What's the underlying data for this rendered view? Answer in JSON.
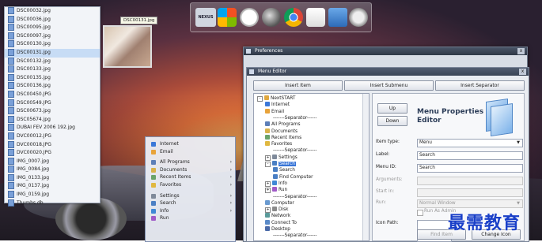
{
  "desktop": {
    "tooltip": "DSC00131.jpg",
    "files": [
      "DSC00032.jpg",
      "DSC00036.jpg",
      "DSC00095.jpg",
      "DSC00097.jpg",
      "DSC00130.jpg",
      "DSC00131.jpg",
      "DSC00132.jpg",
      "DSC00133.jpg",
      "DSC00135.jpg",
      "DSC00136.jpg",
      "DSC00450.JPG",
      "DSC00549.JPG",
      "DSC00673.jpg",
      "DSC05674.jpg",
      "DUBAI FEV 2006 192.jpg",
      "DVC00012.JPG",
      "DVC00018.JPG",
      "DVC00020.JPG",
      "IMG_0007.jpg",
      "IMG_0084.jpg",
      "IMG_0133.jpg",
      "IMG_0137.jpg",
      "IMG_0159.jpg",
      "Thumbs.db"
    ],
    "selected_file_index": 5,
    "dock_icons": [
      "nexus-logo-icon",
      "windows-logo-icon",
      "clock-icon",
      "globe-icon",
      "chrome-icon",
      "mail-icon",
      "photos-icon",
      "system-icon"
    ],
    "dock_logo": "NEXUS"
  },
  "start_menu": {
    "groups": [
      [
        {
          "label": "Internet",
          "icon": "internet-icon"
        },
        {
          "label": "Email",
          "icon": "email-icon"
        }
      ],
      [
        {
          "label": "All Programs",
          "icon": "programs-icon",
          "submenu": true
        },
        {
          "label": "Documents",
          "icon": "documents-icon",
          "submenu": true
        },
        {
          "label": "Recent Items",
          "icon": "recent-icon",
          "submenu": true
        },
        {
          "label": "Favorites",
          "icon": "favorites-icon",
          "submenu": true
        }
      ],
      [
        {
          "label": "Settings",
          "icon": "settings-icon",
          "submenu": true
        },
        {
          "label": "Search",
          "icon": "search-icon",
          "submenu": true
        },
        {
          "label": "Info",
          "icon": "info-icon",
          "submenu": true
        },
        {
          "label": "Run",
          "icon": "run-icon"
        }
      ]
    ]
  },
  "preferences": {
    "title": "Preferences",
    "close": "x"
  },
  "menu_editor": {
    "title": "Menu Editor",
    "close": "x",
    "buttons": {
      "insert_item": "Insert Item",
      "insert_submenu": "Insert Submenu",
      "insert_separator": "Insert Separator",
      "up": "Up",
      "down": "Down",
      "find_item": "Find Item",
      "change_icon": "Change Icon"
    },
    "tree": [
      {
        "label": "NextSTART",
        "depth": 0,
        "expander": "-"
      },
      {
        "label": "Internet",
        "depth": 1
      },
      {
        "label": "Email",
        "depth": 1
      },
      {
        "label": "-------Separator------",
        "depth": 2
      },
      {
        "label": "All Programs",
        "depth": 1
      },
      {
        "label": "Documents",
        "depth": 1
      },
      {
        "label": "Recent Items",
        "depth": 1
      },
      {
        "label": "Favorites",
        "depth": 1
      },
      {
        "label": "-------Separator------",
        "depth": 2
      },
      {
        "label": "Settings",
        "depth": 1,
        "expander": "+"
      },
      {
        "label": "Search",
        "depth": 1,
        "expander": "-",
        "selected": true
      },
      {
        "label": "Search",
        "depth": 2
      },
      {
        "label": "Find Computer",
        "depth": 2
      },
      {
        "label": "Info",
        "depth": 1,
        "expander": "+"
      },
      {
        "label": "Run",
        "depth": 1,
        "expander": "+"
      },
      {
        "label": "-------Separator------",
        "depth": 2
      },
      {
        "label": "Computer",
        "depth": 1
      },
      {
        "label": "Disk",
        "depth": 1,
        "expander": "+"
      },
      {
        "label": "Network",
        "depth": 1
      },
      {
        "label": "Connect To",
        "depth": 1
      },
      {
        "label": "Desktop",
        "depth": 1
      },
      {
        "label": "-------Separator------",
        "depth": 2
      }
    ],
    "properties": {
      "heading": "Menu Properties Editor",
      "item_type_label": "Item type:",
      "item_type_value": "Menu",
      "label_label": "Label:",
      "label_value": "Search",
      "menu_id_label": "Menu ID:",
      "menu_id_value": "Search",
      "arguments_label": "Arguments:",
      "start_in_label": "Start in:",
      "run_label": "Run:",
      "run_value": "Normal Window",
      "run_as_admin": "Run As Admin",
      "icon_path_label": "Icon Path:"
    }
  },
  "watermark": "最需教育"
}
